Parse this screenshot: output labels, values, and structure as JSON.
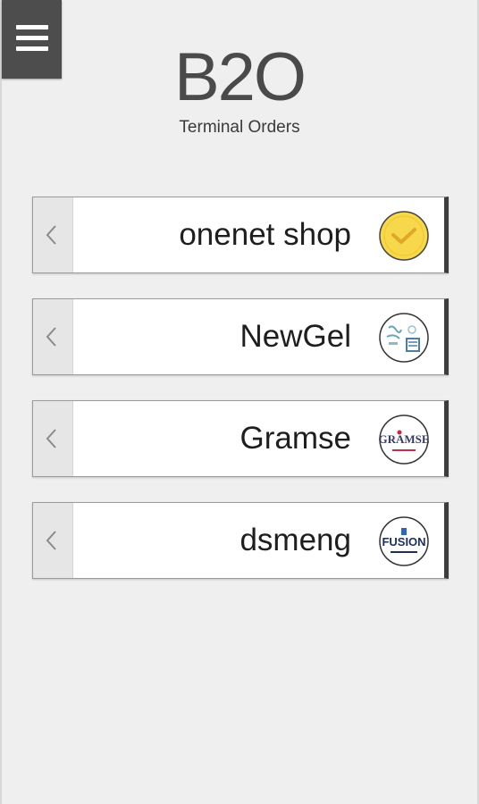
{
  "app": {
    "logo": "B2O",
    "subtitle": "Terminal Orders"
  },
  "menu": {
    "icon": "hamburger-menu-icon"
  },
  "shops": [
    {
      "name": "onenet shop",
      "icon": "check-selected-icon",
      "selected": true
    },
    {
      "name": "NewGel",
      "icon": "newgel-logo-icon",
      "selected": false
    },
    {
      "name": "Gramse",
      "icon": "gramse-logo-icon",
      "selected": false,
      "logo_text": "GRAMSE"
    },
    {
      "name": "dsmeng",
      "icon": "fusion-logo-icon",
      "selected": false,
      "logo_text": "FUSION"
    }
  ],
  "colors": {
    "background": "#efefef",
    "menu_button": "#4d4d4d",
    "check_yellow": "#f7d84a",
    "row_edge": "#3d3d3d"
  }
}
